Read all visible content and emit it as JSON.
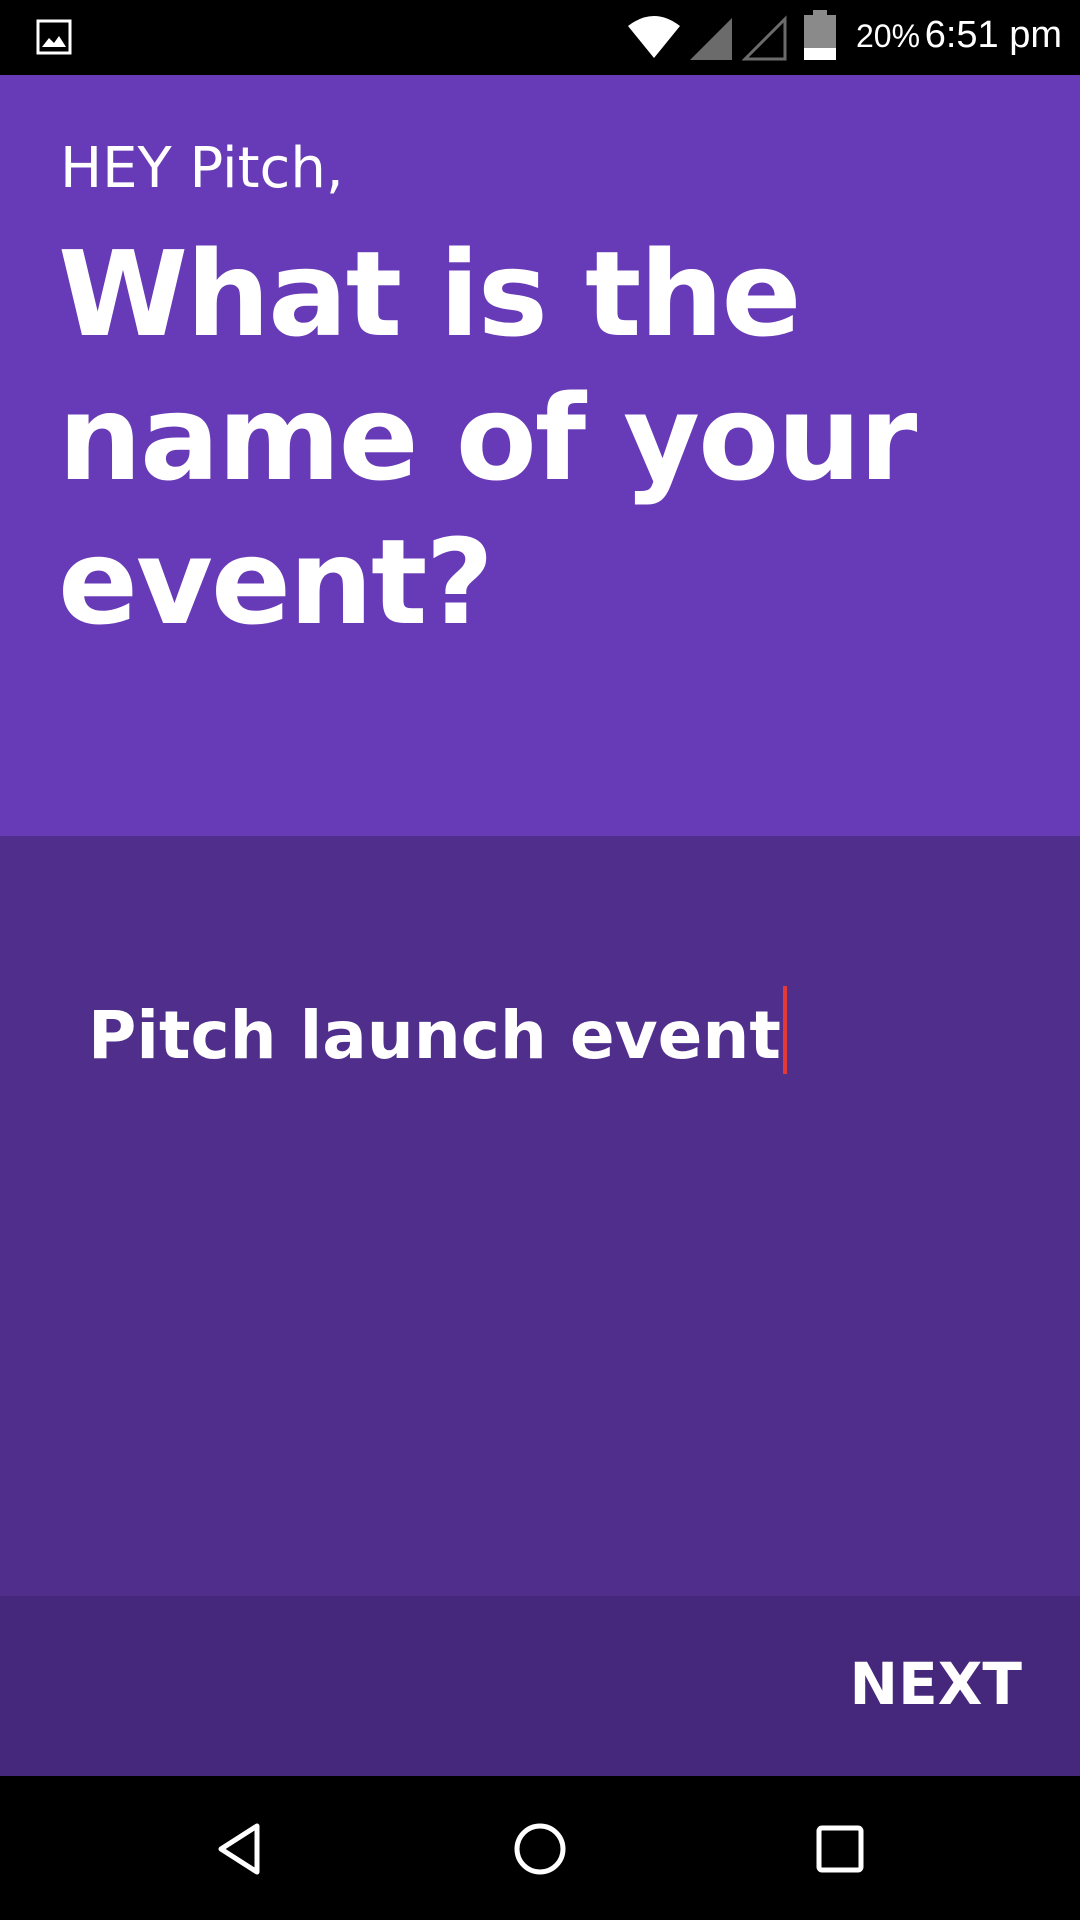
{
  "status_bar": {
    "battery_percent": "20%",
    "time": "6:51 pm",
    "icons": [
      "gallery-icon",
      "wifi-icon",
      "signal-icon",
      "signal-icon-empty",
      "battery-icon"
    ]
  },
  "header": {
    "greeting": "HEY Pitch,",
    "question": "What is the name of your event?",
    "background_color": "#673ab7"
  },
  "event_name": {
    "value": "Pitch launch event",
    "background_color": "#4f2e8c",
    "caret_color": "#e53935"
  },
  "footer": {
    "next_label": "NEXT",
    "background_color": "#45277b"
  },
  "nav_bar": {
    "icons": [
      "back-icon",
      "home-icon",
      "recents-icon"
    ]
  }
}
